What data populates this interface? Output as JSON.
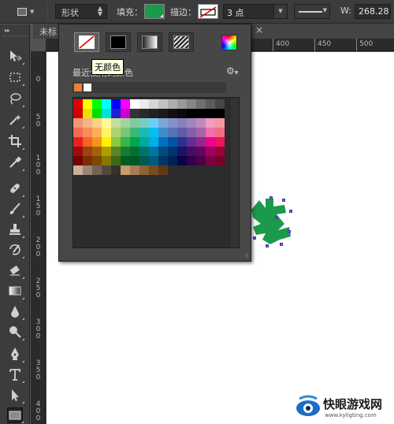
{
  "options_bar": {
    "tool_preset_icon": "rectangle-tool-icon",
    "mode": "形状",
    "fill_label": "填充：",
    "fill_color": "#1a9a4a",
    "stroke_label": "描边：",
    "stroke_width": "3 点",
    "stroke_type_icon": "solid-line-icon",
    "w_label": "W:",
    "w_value": "268.28"
  },
  "doc_tab": {
    "title": "未标"
  },
  "ruler_top": {
    "labels": [
      "400",
      "450",
      "500"
    ]
  },
  "ruler_left": {
    "labels": [
      "0",
      "5 0",
      "1 0 0",
      "1 5 0",
      "2 0 0",
      "2 5 0",
      "3 0 0",
      "3 5 0",
      "4 0 0"
    ]
  },
  "canvas": {
    "shape_color": "#1a9a4a",
    "anchor_color": "#6e5ad8"
  },
  "fill_panel": {
    "type_buttons": [
      {
        "name": "no-color",
        "icon": "no-color-icon"
      },
      {
        "name": "solid-color",
        "icon": "solid-color-icon"
      },
      {
        "name": "gradient",
        "icon": "gradient-icon"
      },
      {
        "name": "pattern",
        "icon": "pattern-icon"
      }
    ],
    "color_picker_icon": "color-picker-icon",
    "tooltip": "无颜色",
    "recent_label": "最近使用的颜色",
    "recent_colors": [
      "#e8823a",
      "#ffffff"
    ],
    "settings_icon": "gear-icon",
    "swatches": [
      [
        "#e00000",
        "#ffff00",
        "#00ff00",
        "#00ffff",
        "#0000ff",
        "#ff00ff",
        "#ffffff",
        "#ebebeb",
        "#d6d6d6",
        "#c2c2c2",
        "#adadad",
        "#999999",
        "#858585",
        "#707070",
        "#5c5c5c",
        "#474747"
      ],
      [
        "#d00000",
        "#f0e000",
        "#00e000",
        "#00e0e0",
        "#1f1fcf",
        "#cc00cc",
        "#333333",
        "#2a2a2a",
        "#222222",
        "#1a1a1a",
        "#111111",
        "#0a0a0a",
        "#000000",
        "#000000",
        "#000000",
        "#000000"
      ],
      [
        "#f0957a",
        "#f5b383",
        "#fbd088",
        "#fff799",
        "#c4df9b",
        "#a3d39c",
        "#82ca9c",
        "#7accc8",
        "#6dcff6",
        "#7da7d9",
        "#8393ca",
        "#8781bd",
        "#a186be",
        "#bd8cbf",
        "#f49ac1",
        "#f5989d"
      ],
      [
        "#f26c4f",
        "#f68e55",
        "#fbaf5c",
        "#fff467",
        "#acd372",
        "#7cc576",
        "#3bb878",
        "#1abbb4",
        "#00bff3",
        "#438ccb",
        "#5574b9",
        "#605ca8",
        "#855fa8",
        "#a763a8",
        "#f06ea9",
        "#f26d7d"
      ],
      [
        "#ed1c24",
        "#f26522",
        "#f7941d",
        "#fff200",
        "#8dc73f",
        "#39b54a",
        "#00a651",
        "#00a99d",
        "#00aeef",
        "#0072bc",
        "#0054a6",
        "#2e3192",
        "#662d91",
        "#92278f",
        "#ec008c",
        "#ed145b"
      ],
      [
        "#9e0b0f",
        "#a0410d",
        "#a3620a",
        "#aba000",
        "#598527",
        "#1a7b30",
        "#007236",
        "#00746b",
        "#0076a3",
        "#004b80",
        "#003471",
        "#1b1464",
        "#440e62",
        "#630460",
        "#9e005d",
        "#9e0039"
      ],
      [
        "#790000",
        "#7b2e00",
        "#7d4900",
        "#827b00",
        "#406618",
        "#005e20",
        "#005826",
        "#005952",
        "#005b7f",
        "#003663",
        "#002157",
        "#0d004c",
        "#32004b",
        "#4b0049",
        "#7b0046",
        "#7a0026"
      ],
      [
        "#c7b299",
        "#998675",
        "#736357",
        "#534741",
        "#37302d",
        "#c69c6d",
        "#a67c52",
        "#8c6239",
        "#754c24",
        "#603913"
      ]
    ]
  },
  "watermark": {
    "title": "快眼游戏网",
    "url": "www.kyligting.com",
    "logo_icon": "eye-logo-icon"
  }
}
